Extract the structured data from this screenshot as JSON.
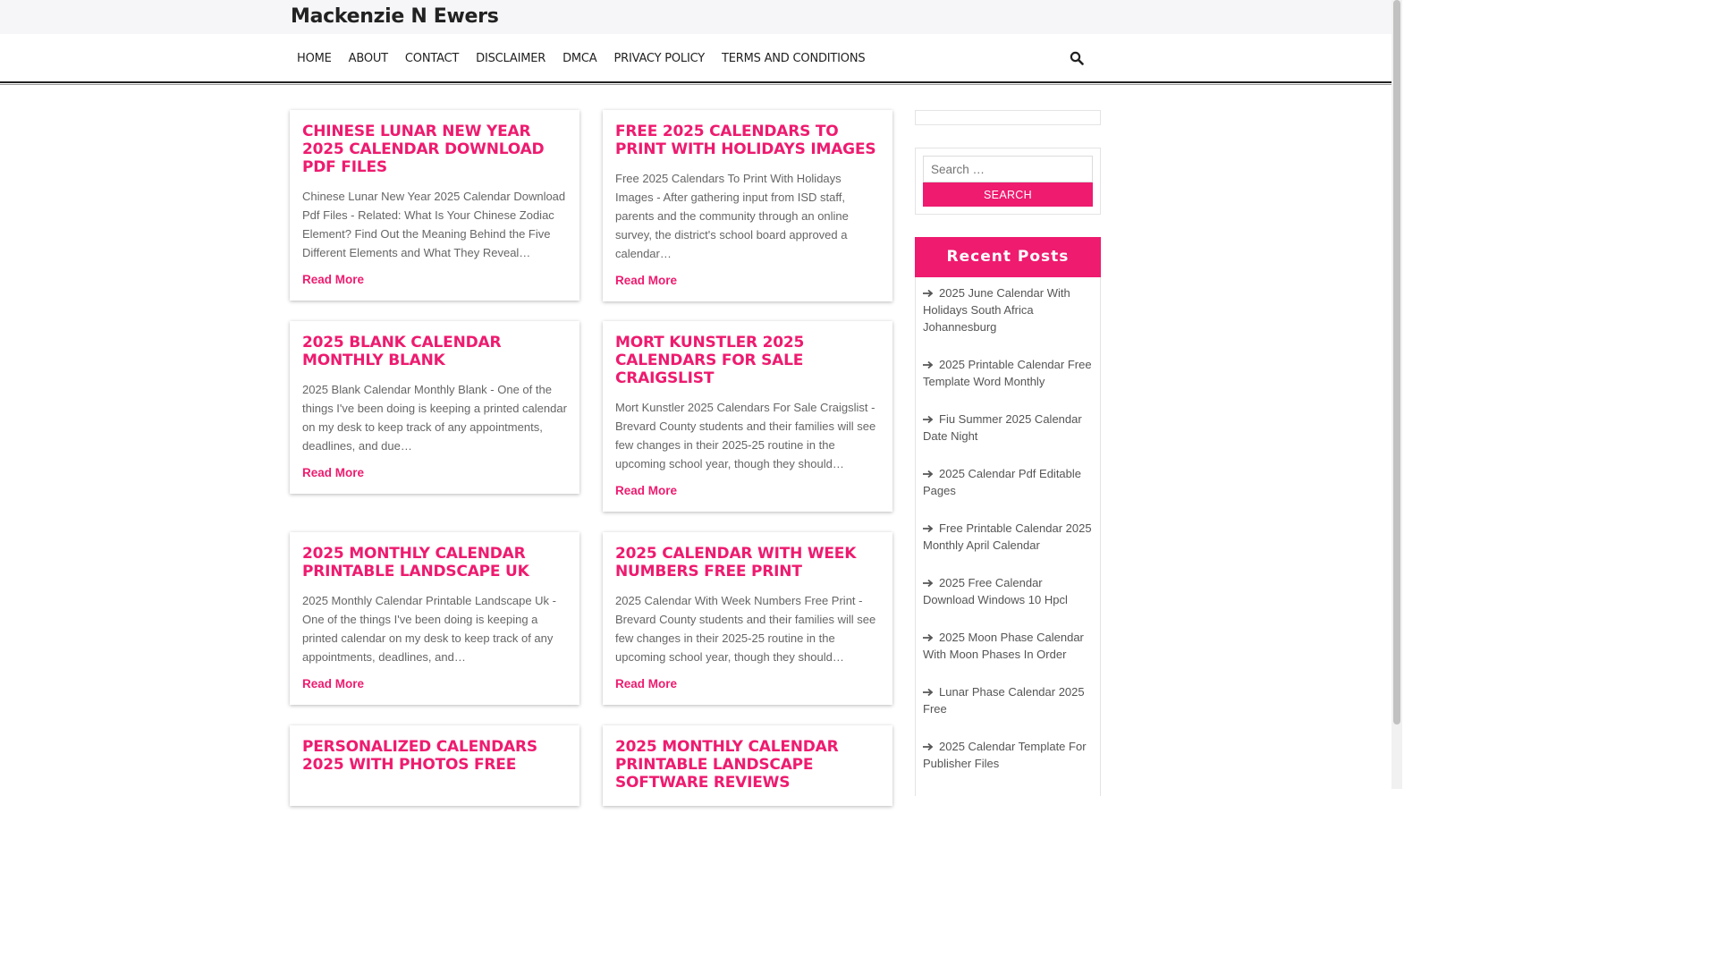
{
  "site": {
    "title": "Mackenzie N Ewers"
  },
  "nav": {
    "items": [
      "HOME",
      "ABOUT",
      "CONTACT",
      "DISCLAIMER",
      "DMCA",
      "PRIVACY POLICY",
      "TERMS AND CONDITIONS"
    ],
    "search_icon": "search-icon"
  },
  "posts": [
    {
      "title": "CHINESE LUNAR NEW YEAR 2025 CALENDAR DOWNLOAD PDF FILES",
      "excerpt": "Chinese Lunar New Year 2025 Calendar Download Pdf Files - Related: What Is Your Chinese Zodiac Element? Find Out the Meaning Behind the Five Different Elements and What They Reveal…",
      "read_more": "Read More"
    },
    {
      "title": "FREE 2025 CALENDARS TO PRINT WITH HOLIDAYS IMAGES",
      "excerpt": "Free 2025 Calendars To Print With Holidays Images - After gathering input from ISD staff, parents and the community through an online survey, the district's school board approved a calendar…",
      "read_more": "Read More"
    },
    {
      "title": "2025 BLANK CALENDAR MONTHLY BLANK",
      "excerpt": "2025 Blank Calendar Monthly Blank - One of the things I've been doing is keeping a printed calendar on my desk to keep track of any appointments, deadlines, and due…",
      "read_more": "Read More"
    },
    {
      "title": "MORT KUNSTLER 2025 CALENDARS FOR SALE CRAIGSLIST",
      "excerpt": "Mort Kunstler 2025 Calendars For Sale Craigslist - Brevard County students and their families will see few changes in their 2025-25 routine in the upcoming school year, though they should…",
      "read_more": "Read More"
    },
    {
      "title": "2025 MONTHLY CALENDAR PRINTABLE LANDSCAPE UK",
      "excerpt": "2025 Monthly Calendar Printable Landscape Uk - One of the things I've been doing is keeping a printed calendar on my desk to keep track of any appointments, deadlines, and…",
      "read_more": "Read More"
    },
    {
      "title": "2025 CALENDAR WITH WEEK NUMBERS FREE PRINT",
      "excerpt": "2025 Calendar With Week Numbers Free Print - Brevard County students and their families will see few changes in their 2025-25 routine in the upcoming school year, though they should…",
      "read_more": "Read More"
    },
    {
      "title": "PERSONALIZED CALENDARS 2025 WITH PHOTOS FREE",
      "excerpt": "",
      "read_more": ""
    },
    {
      "title": "2025 MONTHLY CALENDAR PRINTABLE LANDSCAPE SOFTWARE REVIEWS",
      "excerpt": "",
      "read_more": ""
    }
  ],
  "sidebar": {
    "search": {
      "placeholder": "Search …",
      "button": "SEARCH"
    },
    "recent_posts": {
      "heading": "Recent Posts",
      "items": [
        "2025 June Calendar With Holidays South Africa Johannesburg",
        "2025 Printable Calendar Free Template Word Monthly",
        "Fiu Summer 2025 Calendar Date Night",
        "2025 Calendar Pdf Editable Pages",
        "Free Printable Calendar 2025 Monthly April Calendar",
        "2025 Free Calendar Download Windows 10 Hpcl",
        "2025 Moon Phase Calendar With Moon Phases In Order",
        "Lunar Phase Calendar 2025 Free",
        "2025 Calendar Template For Publisher Files"
      ]
    }
  },
  "colors": {
    "accent": "#ee1b6f",
    "text": "#222222",
    "muted": "#666666"
  }
}
